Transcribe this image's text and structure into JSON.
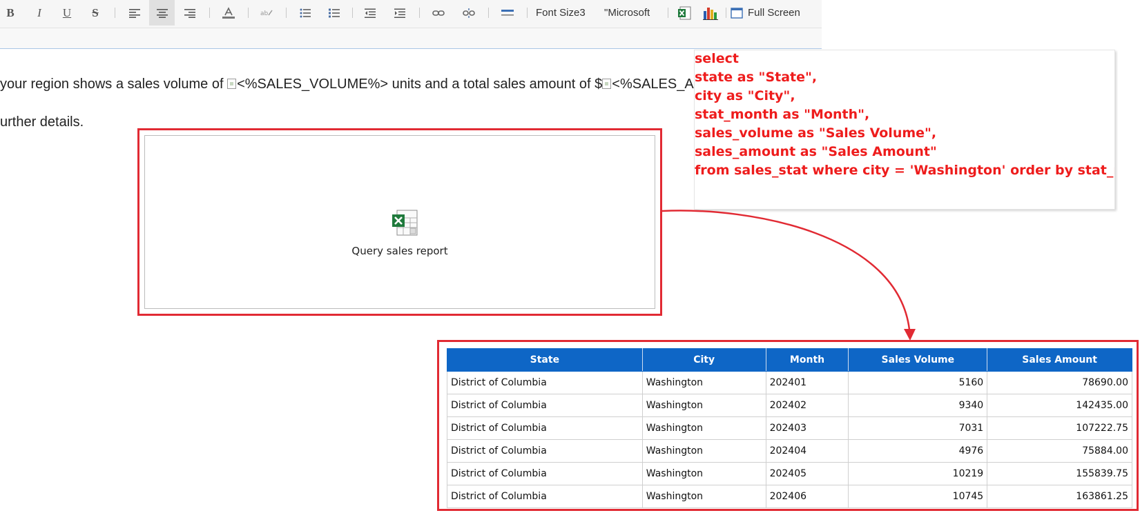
{
  "toolbar": {
    "buttons": [
      {
        "name": "bold-button",
        "glyph": "B"
      },
      {
        "name": "italic-button",
        "glyph": "I"
      },
      {
        "name": "underline-button",
        "glyph": "U"
      },
      {
        "name": "strikethrough-button",
        "glyph": "S"
      }
    ],
    "font_size_label": "Font Size3",
    "font_family_label": "\"Microsoft",
    "fullscreen_label": "Full Screen"
  },
  "document": {
    "line1_part1": "your region shows a sales volume of ",
    "line1_placeholder1": "<%SALES_VOLUME%>",
    "line1_part2": " units and a total sales amount of $",
    "line1_placeholder2": "<%SALES_AMOUNT%>",
    "line2": "urther details."
  },
  "widget": {
    "label": "Query sales report"
  },
  "sql": {
    "lines": [
      "select",
      "state as \"State\",",
      "city as \"City\",",
      "stat_month as \"Month\",",
      "sales_volume as \"Sales Volume\",",
      "sales_amount as \"Sales Amount\"",
      "from sales_stat where city = 'Washington' order by stat_month"
    ],
    "color": "#ee1c1c"
  },
  "colors": {
    "highlight_red": "#e12a33",
    "table_header": "#0e66c6"
  },
  "table": {
    "headers": [
      "State",
      "City",
      "Month",
      "Sales Volume",
      "Sales Amount"
    ],
    "rows": [
      [
        "District of Columbia",
        "Washington",
        "202401",
        "5160",
        "78690.00"
      ],
      [
        "District of Columbia",
        "Washington",
        "202402",
        "9340",
        "142435.00"
      ],
      [
        "District of Columbia",
        "Washington",
        "202403",
        "7031",
        "107222.75"
      ],
      [
        "District of Columbia",
        "Washington",
        "202404",
        "4976",
        "75884.00"
      ],
      [
        "District of Columbia",
        "Washington",
        "202405",
        "10219",
        "155839.75"
      ],
      [
        "District of Columbia",
        "Washington",
        "202406",
        "10745",
        "163861.25"
      ]
    ]
  }
}
